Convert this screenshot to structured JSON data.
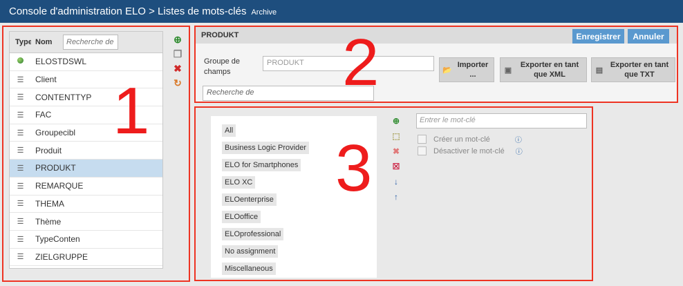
{
  "header": {
    "title": "Console d'administration ELO > Listes de mots-clés",
    "subtitle": "Archive"
  },
  "list_panel": {
    "number": "1",
    "col_type": "Type",
    "col_name": "Nom",
    "search_placeholder": "Recherche de",
    "items": [
      {
        "icon": "globe-icon",
        "label": "ELOSTDSWL"
      },
      {
        "icon": "list-icon",
        "label": "Client"
      },
      {
        "icon": "list-icon",
        "label": "CONTENTTYP"
      },
      {
        "icon": "list-icon",
        "label": "FAC"
      },
      {
        "icon": "list-icon",
        "label": "Groupecibl"
      },
      {
        "icon": "list-icon",
        "label": "Produit"
      },
      {
        "icon": "list-icon",
        "label": "PRODUKT",
        "selected": true
      },
      {
        "icon": "list-icon",
        "label": "REMARQUE"
      },
      {
        "icon": "list-icon",
        "label": "THEMA"
      },
      {
        "icon": "list-icon",
        "label": "Thème"
      },
      {
        "icon": "list-icon",
        "label": "TypeConten"
      },
      {
        "icon": "list-icon",
        "label": "ZIELGRUPPE"
      }
    ]
  },
  "detail_panel": {
    "number": "2",
    "title": "PRODUKT",
    "save_label": "Enregistrer",
    "cancel_label": "Annuler",
    "field_label_line1": "Groupe de",
    "field_label_line2": "champs",
    "field_value": "PRODUKT",
    "search_placeholder": "Recherche de",
    "import_line1": "Importer",
    "import_line2": "...",
    "export_xml_line1": "Exporter en tant",
    "export_xml_line2": "que XML",
    "export_txt_line1": "Exporter en tant",
    "export_txt_line2": "que TXT"
  },
  "keywords_panel": {
    "number": "3",
    "keywords": [
      "All",
      "Business Logic Provider",
      "ELO for Smartphones",
      "ELO XC",
      "ELOenterprise",
      "ELOoffice",
      "ELOprofessional",
      "No assignment",
      "Miscellaneous"
    ],
    "input_placeholder": "Entrer le mot-clé",
    "create_label": "Créer un mot-clé",
    "disable_label": "Désactiver le mot-clé"
  },
  "colors": {
    "header_bg": "#1e4e7e",
    "accent_blue": "#5a99cf",
    "annotation_red": "#ee1c1c",
    "selection": "#c6dcef"
  }
}
